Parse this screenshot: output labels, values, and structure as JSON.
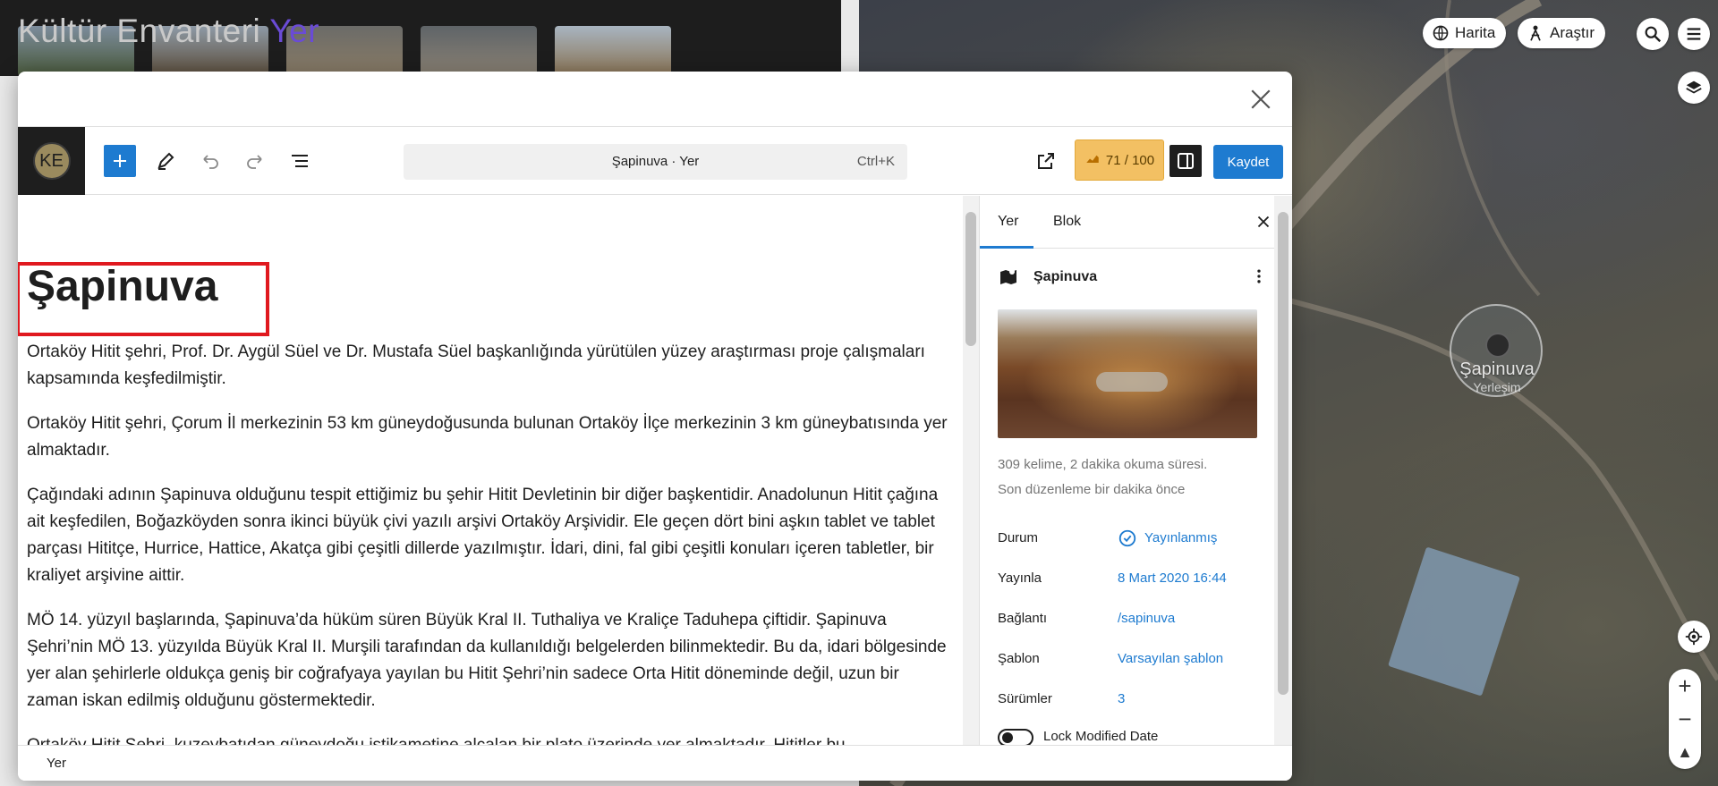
{
  "site": {
    "title_main": "Kültür Envanteri",
    "title_accent": "Yer"
  },
  "map": {
    "buttons": {
      "harita": "Harita",
      "arastir": "Araştır"
    },
    "marker": {
      "name": "Şapinuva",
      "type": "Yerleşim"
    },
    "zoom_in": "+",
    "zoom_out": "−"
  },
  "toolbar": {
    "avatar_initials": "KE",
    "command_title": "Şapinuva · Yer",
    "command_shortcut": "Ctrl+K",
    "seo_score": "71 / 100",
    "save_label": "Kaydet"
  },
  "post": {
    "title": "Şapinuva",
    "paragraphs": [
      "Ortaköy Hitit şehri, Prof. Dr. Aygül Süel ve Dr. Mustafa Süel başkanlığında yürütülen yüzey araştırması proje çalışmaları kapsamında keşfedilmiştir.",
      "Ortaköy Hitit şehri, Çorum İl merkezinin 53 km güneydoğusunda bulunan Ortaköy İlçe merkezinin 3 km güneybatısında yer almaktadır.",
      "Çağındaki adının Şapinuva olduğunu tespit ettiğimiz bu şehir Hitit Devletinin bir diğer başkentidir. Anadolunun Hitit çağına ait keşfedilen, Boğazköyden sonra ikinci büyük çivi yazılı arşivi Ortaköy Arşividir. Ele geçen dört bini aşkın tablet ve tablet parçası Hititçe, Hurrice, Hattice, Akatça gibi çeşitli dillerde yazılmıştır. İdari, dini, fal gibi çeşitli konuları içeren tabletler, bir kraliyet arşivine aittir.",
      "MÖ 14. yüzyıl başlarında, Şapinuva’da hüküm süren Büyük Kral II. Tuthaliya ve Kraliçe Taduhepa çiftidir. Şapinuva Şehri’nin MÖ 13. yüzyılda Büyük Kral II. Murşili tarafından da kullanıldığı belgelerden bilinmektedir. Bu da, idari bölgesinde yer alan şehirlerle oldukça geniş bir coğrafyaya yayılan bu Hitit Şehri’nin sadece Orta Hitit döneminde değil,  uzun bir zaman iskan edilmiş olduğunu göstermektedir.",
      "Ortaköy Hitit Şehri, kuzeybatıdan güneydoğu istikametine alçalan bir plato üzerinde yer almaktadır. Hititler bu"
    ]
  },
  "sidebar": {
    "tabs": [
      "Yer",
      "Blok"
    ],
    "place_name": "Şapinuva",
    "meta_words": "309 kelime, 2 dakika okuma süresi.",
    "meta_edited": "Son düzenleme bir dakika önce",
    "props": [
      {
        "label": "Durum",
        "value": "Yayınlanmış"
      },
      {
        "label": "Yayınla",
        "value": "8 Mart 2020 16:44"
      },
      {
        "label": "Bağlantı",
        "value": "/sapinuva"
      },
      {
        "label": "Şablon",
        "value": "Varsayılan şablon"
      },
      {
        "label": "Sürümler",
        "value": "3"
      }
    ],
    "lock_label": "Lock Modified Date"
  },
  "footer": {
    "breadcrumb": "Yer"
  },
  "colors": {
    "accent_blue": "#1e7bd0",
    "highlight_red": "#e0191f",
    "seo_badge": "#f3c063",
    "site_accent": "#6a4bd6"
  },
  "icons": [
    "globe-icon",
    "compass-person-icon",
    "search-icon",
    "menu-icon",
    "layers-icon",
    "locate-icon",
    "close-icon",
    "plus-icon",
    "pencil-icon",
    "undo-icon",
    "redo-icon",
    "list-view-icon",
    "external-link-icon",
    "seo-icon",
    "sidebar-icon",
    "map-book-icon",
    "more-vertical-icon",
    "check-circle-icon"
  ]
}
